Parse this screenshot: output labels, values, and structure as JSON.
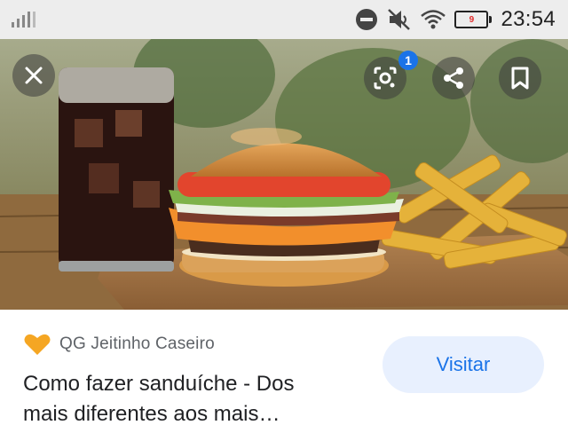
{
  "status_bar": {
    "time": "23:54",
    "battery_level": "9",
    "icons": [
      "signal-icon",
      "do-not-disturb-icon",
      "mute-icon",
      "wifi-icon",
      "battery-icon"
    ]
  },
  "overlay": {
    "lens_badge": "1",
    "icons": [
      "close-icon",
      "lens-icon",
      "share-icon",
      "bookmark-icon"
    ]
  },
  "result": {
    "source_name": "QG Jeitinho Caseiro",
    "title_line1": "Como fazer sanduíche - Dos",
    "title_line2": "mais diferentes aos mais…",
    "visit_label": "Visitar",
    "accent_color": "#1a73e8",
    "source_icon_color": "#f5a623"
  }
}
